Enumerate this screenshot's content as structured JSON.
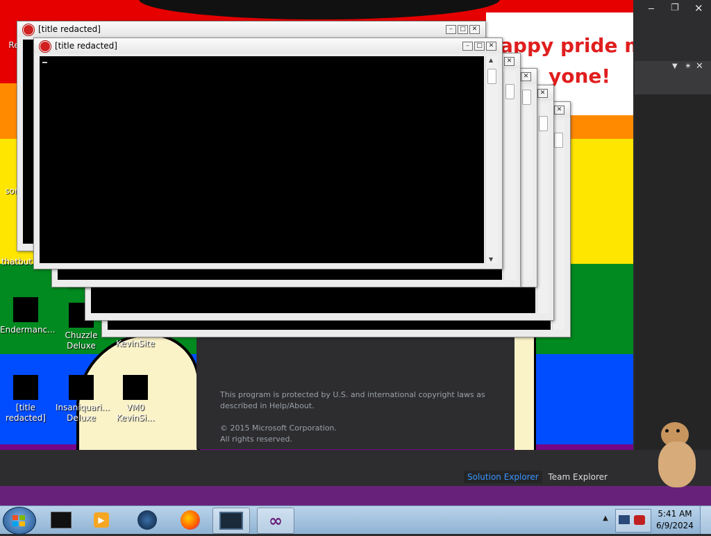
{
  "wallpaper": {
    "banner_text_line1": "appy pride mo",
    "banner_text_line2": "yone!",
    "stripe_colors": [
      "#e60000",
      "#ff8a00",
      "#ffe600",
      "#008a20",
      "#004dff",
      "#750787"
    ]
  },
  "console_windows": [
    {
      "title": "[title redacted]"
    },
    {
      "title": "[title redacted]"
    }
  ],
  "desktop_icons": [
    {
      "label": "Re"
    },
    {
      "label": "som"
    },
    {
      "label": "thatbut"
    },
    {
      "label": "Endermanc..."
    },
    {
      "label": "Chuzzle Deluxe"
    },
    {
      "label": "KevinSite"
    },
    {
      "label": "[title redacted]"
    },
    {
      "label": "Insaniquari... Deluxe"
    },
    {
      "label": "VM0 KevinSi..."
    }
  ],
  "vs_splash": {
    "copyright_line1": "This program is protected by U.S. and international copyright laws as",
    "copyright_line2": "described in Help/About.",
    "corp_line1": "© 2015 Microsoft Corporation.",
    "corp_line2": "All rights reserved."
  },
  "vs_tabs": {
    "solution_explorer": "Solution Explorer",
    "team_explorer": "Team Explorer"
  },
  "clock": {
    "time": "5:41 AM",
    "date": "6/9/2024"
  }
}
